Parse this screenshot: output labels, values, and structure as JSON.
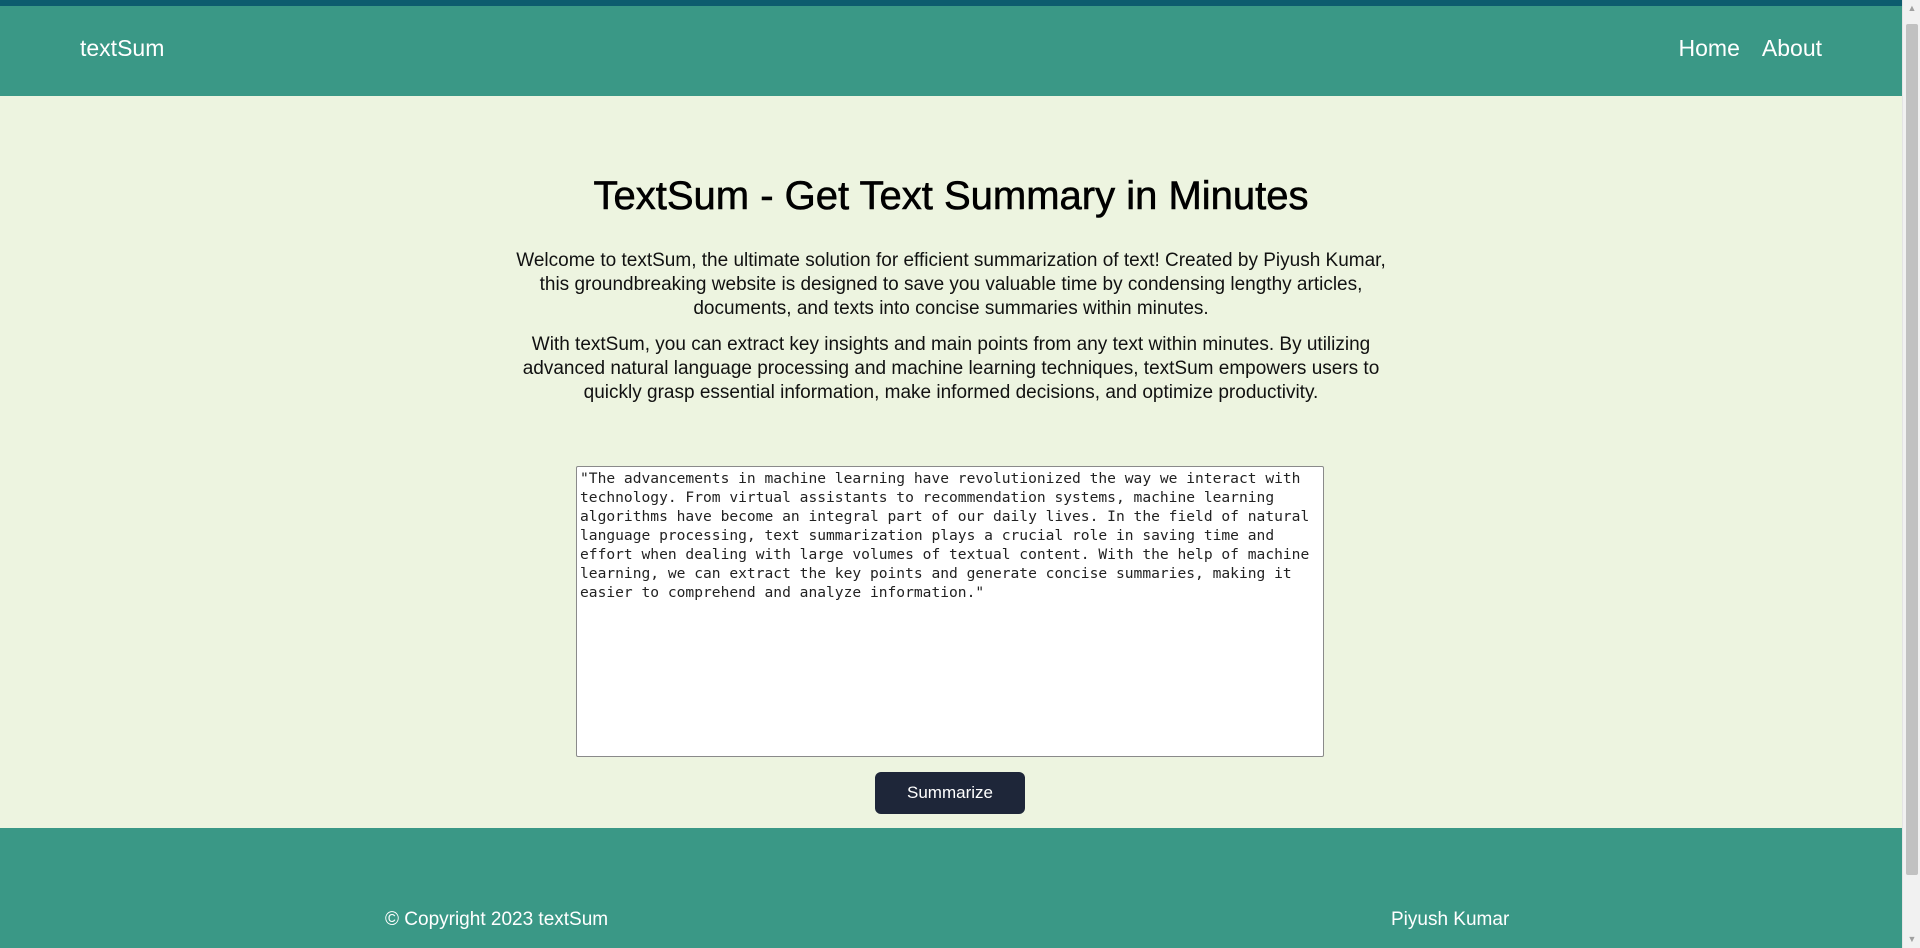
{
  "navbar": {
    "brand": "textSum",
    "links": [
      {
        "label": "Home"
      },
      {
        "label": "About"
      }
    ]
  },
  "main": {
    "title": "TextSum - Get Text Summary in Minutes",
    "paragraphs": [
      "Welcome to textSum, the ultimate solution for efficient summarization of text! Created by Piyush Kumar, this groundbreaking website is designed to save you valuable time by condensing lengthy articles, documents, and texts into concise summaries within minutes.",
      "With textSum, you can extract key insights and main points from any text within minutes. By utilizing advanced natural language processing and machine learning techniques, textSum empowers users to quickly grasp essential information, make informed decisions, and optimize productivity."
    ],
    "input_text": "\"The advancements in machine learning have revolutionized the way we interact with technology. From virtual assistants to recommendation systems, machine learning algorithms have become an integral part of our daily lives. In the field of natural language processing, text summarization plays a crucial role in saving time and effort when dealing with large volumes of textual content. With the help of machine learning, we can extract the key points and generate concise summaries, making it easier to comprehend and analyze information.\"",
    "button_label": "Summarize"
  },
  "footer": {
    "copyright": "© Copyright 2023 textSum",
    "author": "Piyush Kumar"
  },
  "colors": {
    "header_bg": "#3a9886",
    "top_strip": "#0d5c6e",
    "page_bg": "#edf4e0",
    "button_bg": "#1e2639"
  }
}
